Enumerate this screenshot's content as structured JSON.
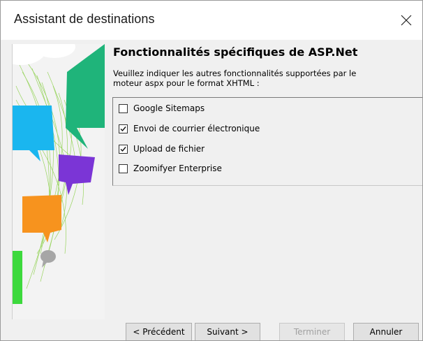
{
  "window": {
    "title": "Assistant de destinations"
  },
  "page": {
    "heading": "Fonctionnalités spécifiques de ASP.Net",
    "description_lines": [
      "Veuillez indiquer les autres fonctionnalités supportées par le",
      "moteur aspx pour le format XHTML :"
    ]
  },
  "features": [
    {
      "label": "Google Sitemaps",
      "checked": false
    },
    {
      "label": "Envoi de courrier électronique",
      "checked": true
    },
    {
      "label": "Upload de fichier",
      "checked": true
    },
    {
      "label": "Zoomifyer Enterprise",
      "checked": false
    }
  ],
  "buttons": {
    "previous": "< Précédent",
    "next": "Suivant >",
    "finish": "Terminer",
    "cancel": "Annuler",
    "finish_enabled": false
  },
  "icons": {
    "close": "close-icon",
    "checkmark": "checkmark-icon"
  },
  "colors": {
    "title_bg": "#ffffff",
    "dialog_bg": "#f0f0f0",
    "bubble_green": "#1fb47a",
    "bubble_blue": "#1ab6ef",
    "bubble_purple": "#7b35d6",
    "bubble_orange": "#f7931e",
    "bubble_gray": "#a6a6a6",
    "bar_green": "#3dd93d"
  }
}
